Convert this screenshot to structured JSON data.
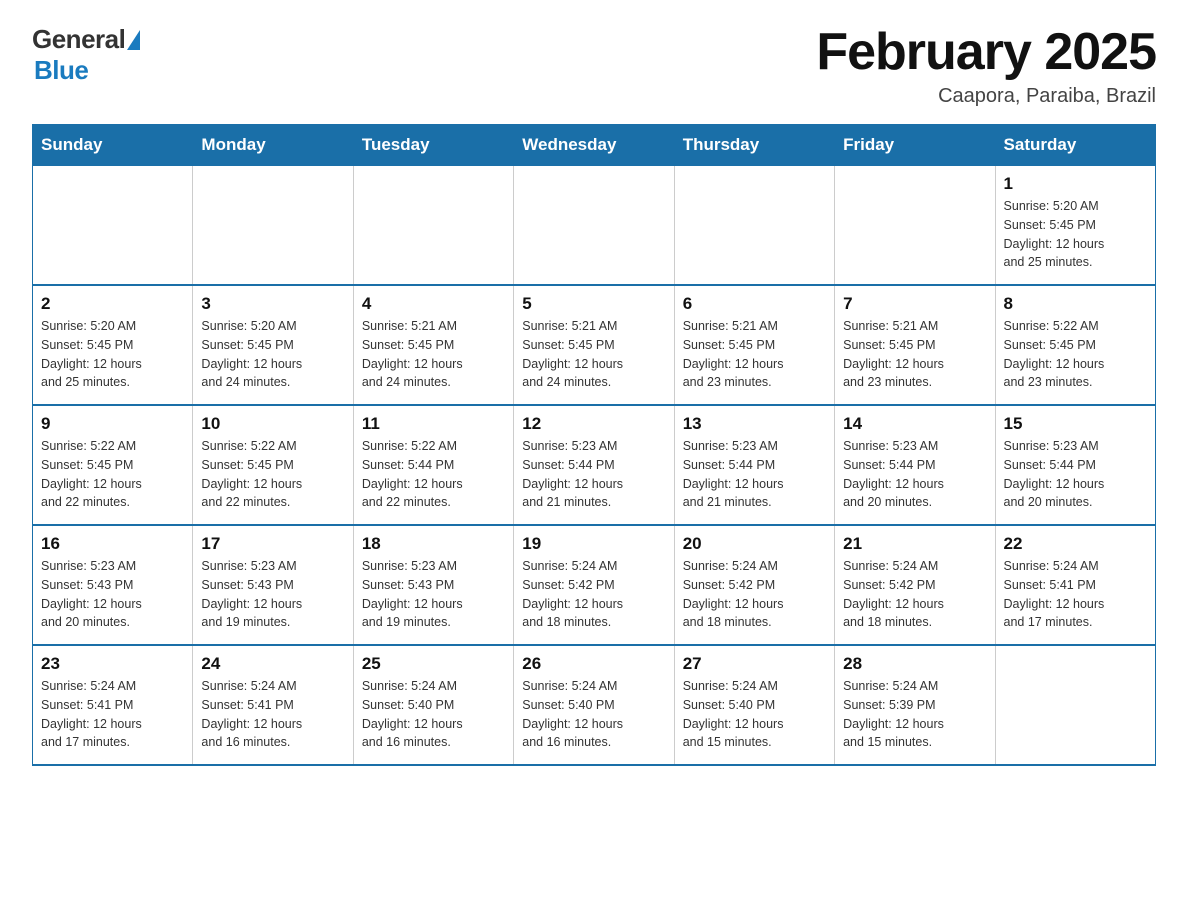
{
  "header": {
    "logo_general": "General",
    "logo_blue": "Blue",
    "title": "February 2025",
    "subtitle": "Caapora, Paraiba, Brazil"
  },
  "days_of_week": [
    "Sunday",
    "Monday",
    "Tuesday",
    "Wednesday",
    "Thursday",
    "Friday",
    "Saturday"
  ],
  "weeks": [
    [
      {
        "num": "",
        "info": ""
      },
      {
        "num": "",
        "info": ""
      },
      {
        "num": "",
        "info": ""
      },
      {
        "num": "",
        "info": ""
      },
      {
        "num": "",
        "info": ""
      },
      {
        "num": "",
        "info": ""
      },
      {
        "num": "1",
        "info": "Sunrise: 5:20 AM\nSunset: 5:45 PM\nDaylight: 12 hours\nand 25 minutes."
      }
    ],
    [
      {
        "num": "2",
        "info": "Sunrise: 5:20 AM\nSunset: 5:45 PM\nDaylight: 12 hours\nand 25 minutes."
      },
      {
        "num": "3",
        "info": "Sunrise: 5:20 AM\nSunset: 5:45 PM\nDaylight: 12 hours\nand 24 minutes."
      },
      {
        "num": "4",
        "info": "Sunrise: 5:21 AM\nSunset: 5:45 PM\nDaylight: 12 hours\nand 24 minutes."
      },
      {
        "num": "5",
        "info": "Sunrise: 5:21 AM\nSunset: 5:45 PM\nDaylight: 12 hours\nand 24 minutes."
      },
      {
        "num": "6",
        "info": "Sunrise: 5:21 AM\nSunset: 5:45 PM\nDaylight: 12 hours\nand 23 minutes."
      },
      {
        "num": "7",
        "info": "Sunrise: 5:21 AM\nSunset: 5:45 PM\nDaylight: 12 hours\nand 23 minutes."
      },
      {
        "num": "8",
        "info": "Sunrise: 5:22 AM\nSunset: 5:45 PM\nDaylight: 12 hours\nand 23 minutes."
      }
    ],
    [
      {
        "num": "9",
        "info": "Sunrise: 5:22 AM\nSunset: 5:45 PM\nDaylight: 12 hours\nand 22 minutes."
      },
      {
        "num": "10",
        "info": "Sunrise: 5:22 AM\nSunset: 5:45 PM\nDaylight: 12 hours\nand 22 minutes."
      },
      {
        "num": "11",
        "info": "Sunrise: 5:22 AM\nSunset: 5:44 PM\nDaylight: 12 hours\nand 22 minutes."
      },
      {
        "num": "12",
        "info": "Sunrise: 5:23 AM\nSunset: 5:44 PM\nDaylight: 12 hours\nand 21 minutes."
      },
      {
        "num": "13",
        "info": "Sunrise: 5:23 AM\nSunset: 5:44 PM\nDaylight: 12 hours\nand 21 minutes."
      },
      {
        "num": "14",
        "info": "Sunrise: 5:23 AM\nSunset: 5:44 PM\nDaylight: 12 hours\nand 20 minutes."
      },
      {
        "num": "15",
        "info": "Sunrise: 5:23 AM\nSunset: 5:44 PM\nDaylight: 12 hours\nand 20 minutes."
      }
    ],
    [
      {
        "num": "16",
        "info": "Sunrise: 5:23 AM\nSunset: 5:43 PM\nDaylight: 12 hours\nand 20 minutes."
      },
      {
        "num": "17",
        "info": "Sunrise: 5:23 AM\nSunset: 5:43 PM\nDaylight: 12 hours\nand 19 minutes."
      },
      {
        "num": "18",
        "info": "Sunrise: 5:23 AM\nSunset: 5:43 PM\nDaylight: 12 hours\nand 19 minutes."
      },
      {
        "num": "19",
        "info": "Sunrise: 5:24 AM\nSunset: 5:42 PM\nDaylight: 12 hours\nand 18 minutes."
      },
      {
        "num": "20",
        "info": "Sunrise: 5:24 AM\nSunset: 5:42 PM\nDaylight: 12 hours\nand 18 minutes."
      },
      {
        "num": "21",
        "info": "Sunrise: 5:24 AM\nSunset: 5:42 PM\nDaylight: 12 hours\nand 18 minutes."
      },
      {
        "num": "22",
        "info": "Sunrise: 5:24 AM\nSunset: 5:41 PM\nDaylight: 12 hours\nand 17 minutes."
      }
    ],
    [
      {
        "num": "23",
        "info": "Sunrise: 5:24 AM\nSunset: 5:41 PM\nDaylight: 12 hours\nand 17 minutes."
      },
      {
        "num": "24",
        "info": "Sunrise: 5:24 AM\nSunset: 5:41 PM\nDaylight: 12 hours\nand 16 minutes."
      },
      {
        "num": "25",
        "info": "Sunrise: 5:24 AM\nSunset: 5:40 PM\nDaylight: 12 hours\nand 16 minutes."
      },
      {
        "num": "26",
        "info": "Sunrise: 5:24 AM\nSunset: 5:40 PM\nDaylight: 12 hours\nand 16 minutes."
      },
      {
        "num": "27",
        "info": "Sunrise: 5:24 AM\nSunset: 5:40 PM\nDaylight: 12 hours\nand 15 minutes."
      },
      {
        "num": "28",
        "info": "Sunrise: 5:24 AM\nSunset: 5:39 PM\nDaylight: 12 hours\nand 15 minutes."
      },
      {
        "num": "",
        "info": ""
      }
    ]
  ]
}
